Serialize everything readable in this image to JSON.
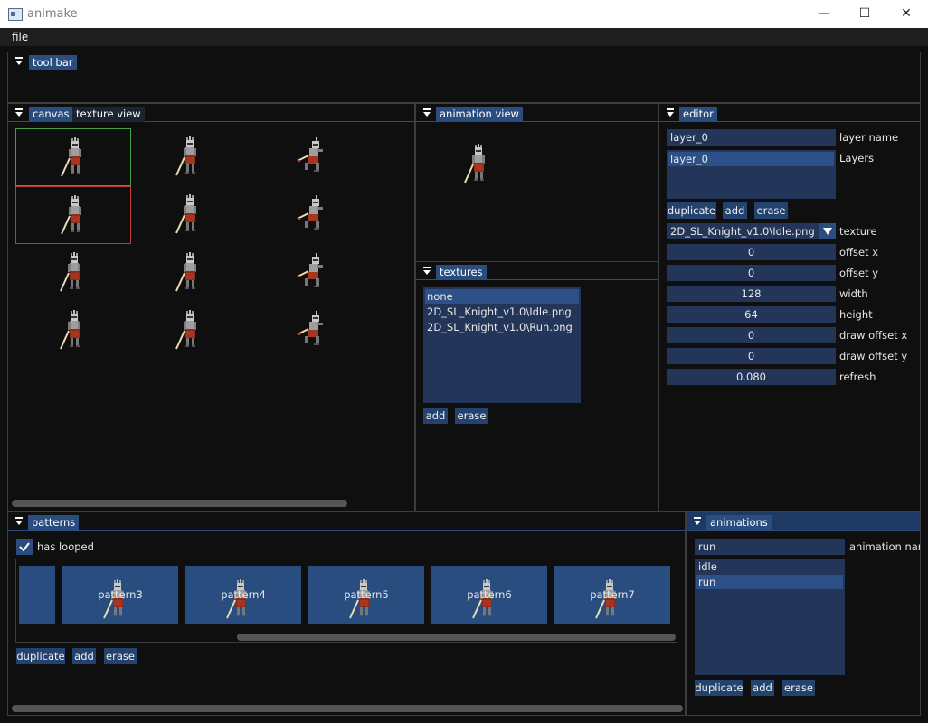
{
  "window": {
    "title": "animake",
    "minimize": "—",
    "maximize": "☐",
    "close": "✕"
  },
  "menu": {
    "file": "file"
  },
  "toolbar": {
    "tab": "tool bar"
  },
  "canvas": {
    "tabs": [
      "canvas",
      "texture view"
    ]
  },
  "animation_view": {
    "tab": "animation view"
  },
  "textures": {
    "tab": "textures",
    "items": [
      "none",
      "2D_SL_Knight_v1.0\\Idle.png",
      "2D_SL_Knight_v1.0\\Run.png"
    ],
    "selected_index": 0,
    "add": "add",
    "erase": "erase"
  },
  "editor": {
    "tab": "editor",
    "layer_name_value": "layer_0",
    "layer_name_label": "layer name",
    "layers_label": "Layers",
    "layers": [
      "layer_0"
    ],
    "duplicate": "duplicate",
    "add": "add",
    "erase": "erase",
    "texture_value": "2D_SL_Knight_v1.0\\Idle.png",
    "texture_label": "texture",
    "props": [
      {
        "value": "0",
        "label": "offset x"
      },
      {
        "value": "0",
        "label": "offset y"
      },
      {
        "value": "128",
        "label": "width"
      },
      {
        "value": "64",
        "label": "height"
      },
      {
        "value": "0",
        "label": "draw offset x"
      },
      {
        "value": "0",
        "label": "draw offset y"
      },
      {
        "value": "0.080",
        "label": "refresh"
      }
    ]
  },
  "patterns": {
    "tab": "patterns",
    "has_looped_label": "has looped",
    "has_looped": true,
    "items": [
      "pattern3",
      "pattern4",
      "pattern5",
      "pattern6",
      "pattern7"
    ],
    "duplicate": "duplicate",
    "add": "add",
    "erase": "erase"
  },
  "animations": {
    "tab": "animations",
    "name_value": "run",
    "name_label": "animation name",
    "items": [
      "idle",
      "run"
    ],
    "selected_index": 1,
    "duplicate": "duplicate",
    "add": "add",
    "erase": "erase"
  },
  "colors": {
    "accent": "#2a4d80",
    "field": "#233659",
    "selection_green": "#3fa04a",
    "selection_red": "#c03838"
  }
}
